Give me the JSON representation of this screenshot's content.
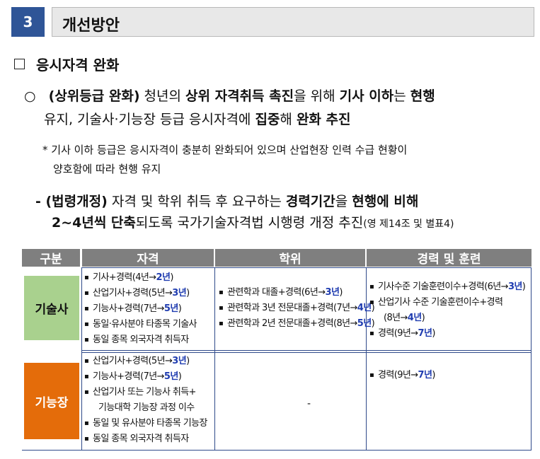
{
  "section": {
    "number": "3",
    "title": "개선방안"
  },
  "subsection": {
    "title": "응시자격 완화"
  },
  "main_point": {
    "bullet": "○",
    "l1_a": "(상위등급 완화)",
    "l1_b": " 청년의 ",
    "l1_c": "상위 자격취득 촉진",
    "l1_d": "을 위해 ",
    "l1_e": "기사 이하",
    "l1_f": "는 ",
    "l1_g": "현행",
    "l2_a": "유지, 기술사·기능장 등급 응시자격",
    "l2_b": "에 ",
    "l2_c": "집중",
    "l2_d": "해 ",
    "l2_e": "완화 추진"
  },
  "note": {
    "line1": "* 기사 이하 등급은 응시자격이 충분히 완화되어 있으며 산업현장 인력 수급 현황이",
    "line2": "양호함에 따라 현행 유지"
  },
  "sub_point": {
    "l3_a": "- (법령개정)",
    "l3_b": " 자격 및 학위 취득 후 요구하는 ",
    "l3_c": "경력기간",
    "l3_d": "을 ",
    "l3_e": "현행에 비해",
    "l4_a": "2~4년씩 단축",
    "l4_b": "되도록 국가기술자격법 시행령 개정 추진",
    "l4_c": "(영 제14조 및 별표4)"
  },
  "table": {
    "headers": {
      "gubun": "구분",
      "jakyeok": "자격",
      "hakwi": "학위",
      "career": "경력 및 훈련"
    },
    "rows": {
      "gisulsa": {
        "label": "기술사",
        "jakyeok": [
          {
            "pre": "기사+경력(4년→",
            "hl": "2년",
            "post": ")"
          },
          {
            "pre": "산업기사+경력(5년→",
            "hl": "3년",
            "post": ")"
          },
          {
            "pre": "기능사+경력(7년→",
            "hl": "5년",
            "post": ")"
          },
          {
            "pre": "동일·유사분야 타종목 기술사",
            "hl": "",
            "post": ""
          },
          {
            "pre": "동일 종목 외국자격 취득자",
            "hl": "",
            "post": ""
          }
        ],
        "hakwi": [
          {
            "pre": "관련학과 대졸+경력(6년→",
            "hl": "3년",
            "post": ")"
          },
          {
            "pre": "관련학과 3년 전문대졸+경력(7년→",
            "hl": "4년",
            "post": ")"
          },
          {
            "pre": "관련학과 2년 전문대졸+경력(8년→",
            "hl": "5년",
            "post": ")"
          }
        ],
        "career": [
          {
            "pre": "기사수준 기술훈련이수+경력(6년→",
            "hl": "3년",
            "post": ")"
          },
          {
            "pre": "산업기사 수준 기술훈련이수+경력",
            "hl": "",
            "post": ""
          },
          {
            "pre": "(8년→",
            "hl": "4년",
            "post": ")"
          },
          {
            "pre": "경력(9년→",
            "hl": "7년",
            "post": ")"
          }
        ]
      },
      "gineungjang": {
        "label": "기능장",
        "jakyeok": [
          {
            "pre": "산업기사+경력(5년→",
            "hl": "3년",
            "post": ")"
          },
          {
            "pre": "기능사+경력(7년→",
            "hl": "5년",
            "post": ")"
          },
          {
            "pre": "산업기사 또는 기능사 취득+",
            "hl": "",
            "post": ""
          },
          {
            "pre": "기능대학 기능장 과정 이수",
            "hl": "",
            "post": ""
          },
          {
            "pre": "동일 및 유사분야 타종목 기능장",
            "hl": "",
            "post": ""
          },
          {
            "pre": "동일 종목 외국자격 취득자",
            "hl": "",
            "post": ""
          }
        ],
        "hakwi": "-",
        "career": [
          {
            "pre": "경력(9년→",
            "hl": "7년",
            "post": ")"
          }
        ]
      }
    }
  }
}
